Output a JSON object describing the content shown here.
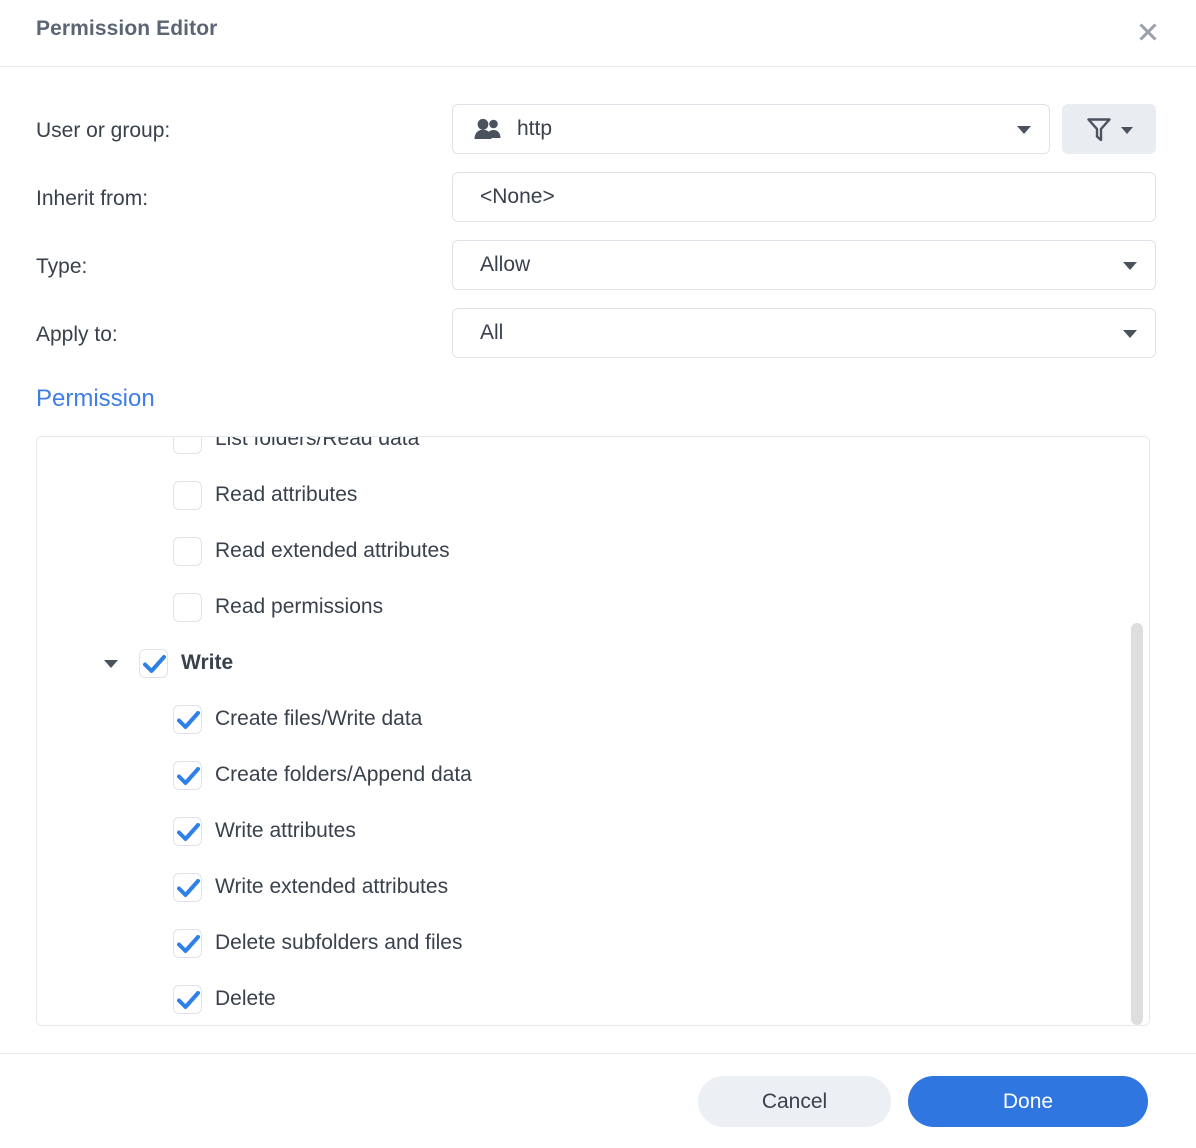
{
  "dialog": {
    "title": "Permission Editor",
    "close_icon": "close-icon",
    "accent_color": "#2f76e0",
    "section_title_color": "#3e7ee6"
  },
  "form": {
    "user_or_group": {
      "label": "User or group:",
      "value": "http",
      "icon": "group-icon",
      "caret_icon": "chevron-down-icon"
    },
    "filter_button": {
      "icon": "filter-icon",
      "caret_icon": "chevron-down-icon"
    },
    "inherit_from": {
      "label": "Inherit from:",
      "value": "<None>"
    },
    "type": {
      "label": "Type:",
      "value": "Allow",
      "caret_icon": "chevron-down-icon"
    },
    "apply_to": {
      "label": "Apply to:",
      "value": "All",
      "caret_icon": "chevron-down-icon"
    }
  },
  "permission": {
    "section_title": "Permission",
    "items": [
      {
        "label": "List folders/Read data",
        "checked": false,
        "level": "child",
        "clipped": true
      },
      {
        "label": "Read attributes",
        "checked": false,
        "level": "child"
      },
      {
        "label": "Read extended attributes",
        "checked": false,
        "level": "child"
      },
      {
        "label": "Read permissions",
        "checked": false,
        "level": "child"
      },
      {
        "label": "Write",
        "checked": true,
        "level": "group",
        "expanded": true,
        "twisty_icon": "caret-down-icon"
      },
      {
        "label": "Create files/Write data",
        "checked": true,
        "level": "child"
      },
      {
        "label": "Create folders/Append data",
        "checked": true,
        "level": "child"
      },
      {
        "label": "Write attributes",
        "checked": true,
        "level": "child"
      },
      {
        "label": "Write extended attributes",
        "checked": true,
        "level": "child"
      },
      {
        "label": "Delete subfolders and files",
        "checked": true,
        "level": "child"
      },
      {
        "label": "Delete",
        "checked": true,
        "level": "child"
      }
    ]
  },
  "footer": {
    "cancel_label": "Cancel",
    "done_label": "Done"
  }
}
